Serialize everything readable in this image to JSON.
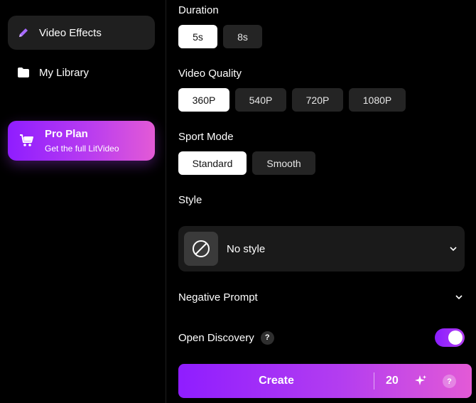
{
  "sidebar": {
    "items": [
      {
        "label": "Video Effects",
        "icon": "pencil-icon",
        "active": true
      },
      {
        "label": "My Library",
        "icon": "folder-icon",
        "active": false
      }
    ],
    "pro_plan": {
      "title": "Pro Plan",
      "subtitle": "Get the full LitVideo",
      "icon": "cart-icon"
    }
  },
  "settings": {
    "duration": {
      "label": "Duration",
      "options": [
        "5s",
        "8s"
      ],
      "selected": "5s"
    },
    "video_quality": {
      "label": "Video Quality",
      "options": [
        "360P",
        "540P",
        "720P",
        "1080P"
      ],
      "selected": "360P"
    },
    "sport_mode": {
      "label": "Sport Mode",
      "options": [
        "Standard",
        "Smooth"
      ],
      "selected": "Standard"
    },
    "style": {
      "label": "Style",
      "value": "No style",
      "icon": "no-style-icon"
    },
    "negative_prompt": {
      "label": "Negative Prompt"
    },
    "open_discovery": {
      "label": "Open Discovery",
      "enabled": true,
      "help": "?"
    }
  },
  "create": {
    "label": "Create",
    "credits": "20",
    "help": "?"
  },
  "colors": {
    "accent_start": "#8f1dff",
    "accent_end": "#e35ad6",
    "panel": "#1a1a1a",
    "chip": "#242424"
  }
}
